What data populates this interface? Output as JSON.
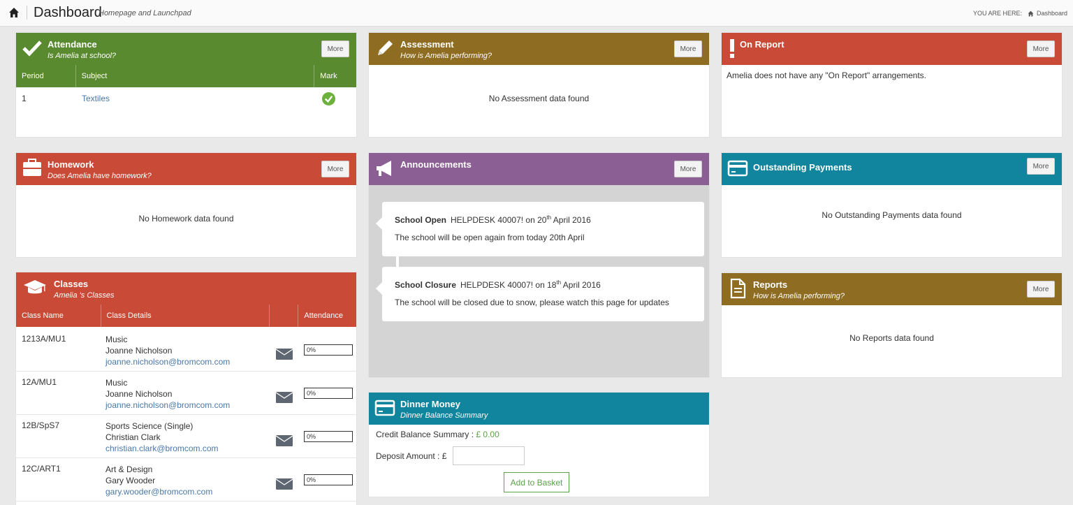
{
  "topbar": {
    "title": "Dashboard",
    "subtitle": "Homepage and Launchpad",
    "crumb_label": "YOU ARE HERE:",
    "crumb_page": "Dashboard"
  },
  "more_label": "More",
  "attendance": {
    "title": "Attendance",
    "subtitle": "Is Amelia at school?",
    "columns": [
      "Period",
      "Subject",
      "Mark"
    ],
    "rows": [
      {
        "period": "1",
        "subject": "Textiles",
        "mark": "present"
      }
    ]
  },
  "assessment": {
    "title": "Assessment",
    "subtitle": "How is Amelia performing?",
    "empty": "No Assessment data found"
  },
  "on_report": {
    "title": "On Report",
    "message": "Amelia does not have any \"On Report\" arrangements."
  },
  "homework": {
    "title": "Homework",
    "subtitle": "Does Amelia have homework?",
    "empty": "No Homework data found"
  },
  "announcements": {
    "title": "Announcements",
    "items": [
      {
        "title": "School Open",
        "source": "HELPDESK 40007! on 20",
        "ordinal": "th",
        "date_rest": "April 2016",
        "body": "The school will be open again from today 20th April"
      },
      {
        "title": "School Closure",
        "source": "HELPDESK 40007! on 18",
        "ordinal": "th",
        "date_rest": "April 2016",
        "body": "The school will be closed due to snow, please watch this page for updates"
      }
    ]
  },
  "outstanding_payments": {
    "title": "Outstanding Payments",
    "empty": "No Outstanding Payments data found"
  },
  "reports": {
    "title": "Reports",
    "subtitle": "How is Amelia performing?",
    "empty": "No Reports data found"
  },
  "classes": {
    "title": "Classes",
    "subtitle": "Amelia 's Classes",
    "columns": [
      "Class Name",
      "Class Details",
      "",
      "Attendance"
    ],
    "rows": [
      {
        "name": "1213A/MU1",
        "subject": "Music",
        "teacher": "Joanne Nicholson",
        "email": "joanne.nicholson@bromcom.com",
        "attendance": "0%"
      },
      {
        "name": "12A/MU1",
        "subject": "Music",
        "teacher": "Joanne Nicholson",
        "email": "joanne.nicholson@bromcom.com",
        "attendance": "0%"
      },
      {
        "name": "12B/SpS7",
        "subject": "Sports Science (Single)",
        "teacher": "Christian Clark",
        "email": "christian.clark@bromcom.com",
        "attendance": "0%"
      },
      {
        "name": "12C/ART1",
        "subject": "Art & Design",
        "teacher": "Gary Wooder",
        "email": "gary.wooder@bromcom.com",
        "attendance": "0%"
      }
    ]
  },
  "dinner_money": {
    "title": "Dinner Money",
    "subtitle": "Dinner Balance Summary",
    "credit_label": "Credit Balance Summary :",
    "credit_value": "£ 0.00",
    "deposit_label": "Deposit Amount : £",
    "deposit_value": "",
    "button": "Add to Basket"
  },
  "colors": {
    "green": "#5a8a2f",
    "orange": "#8e6d23",
    "red": "#c94a36",
    "purple": "#8c5f94",
    "teal": "#11849e"
  }
}
